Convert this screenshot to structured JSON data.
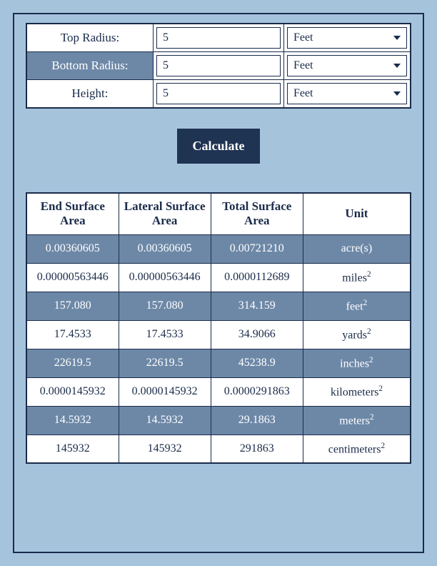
{
  "form": {
    "rows": [
      {
        "label": "Top Radius:",
        "value": "5",
        "unit": "Feet",
        "alt": false
      },
      {
        "label": "Bottom Radius:",
        "value": "5",
        "unit": "Feet",
        "alt": true
      },
      {
        "label": "Height:",
        "value": "5",
        "unit": "Feet",
        "alt": false
      }
    ]
  },
  "calculate_label": "Calculate",
  "results": {
    "headers": [
      "End Surface Area",
      "Lateral Surface Area",
      "Total Surface Area",
      "Unit"
    ],
    "rows": [
      {
        "end": "0.00360605",
        "lateral": "0.00360605",
        "total": "0.00721210",
        "unit": "acre(s)",
        "sup": "",
        "shade": true
      },
      {
        "end": "0.00000563446",
        "lateral": "0.00000563446",
        "total": "0.0000112689",
        "unit": "miles",
        "sup": "2",
        "shade": false
      },
      {
        "end": "157.080",
        "lateral": "157.080",
        "total": "314.159",
        "unit": "feet",
        "sup": "2",
        "shade": true
      },
      {
        "end": "17.4533",
        "lateral": "17.4533",
        "total": "34.9066",
        "unit": "yards",
        "sup": "2",
        "shade": false
      },
      {
        "end": "22619.5",
        "lateral": "22619.5",
        "total": "45238.9",
        "unit": "inches",
        "sup": "2",
        "shade": true
      },
      {
        "end": "0.000014593​2",
        "lateral": "0.000014593​2",
        "total": "0.000029186​3",
        "unit": "kilometers",
        "sup": "2",
        "shade": false
      },
      {
        "end": "14.5932",
        "lateral": "14.5932",
        "total": "29.1863",
        "unit": "meters",
        "sup": "2",
        "shade": true
      },
      {
        "end": "145932",
        "lateral": "145932",
        "total": "291863",
        "unit": "centimeters",
        "sup": "2",
        "shade": false
      }
    ]
  }
}
